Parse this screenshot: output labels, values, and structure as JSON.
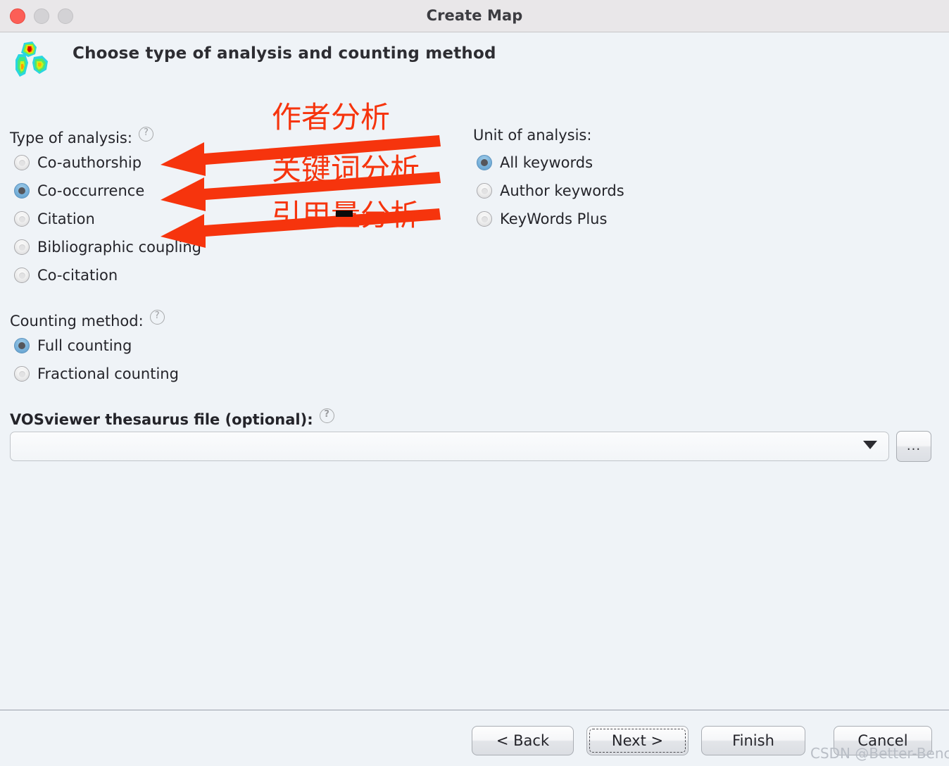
{
  "window": {
    "title": "Create Map",
    "controls": [
      "close-button",
      "minimize-button",
      "maximize-button"
    ]
  },
  "header": {
    "title": "Choose type of analysis and counting method",
    "logo": "vosviewer-heatmap-logo"
  },
  "type_of_analysis": {
    "label": "Type of analysis:",
    "help": "?",
    "options": [
      {
        "label": "Co-authorship",
        "selected": false
      },
      {
        "label": "Co-occurrence",
        "selected": true
      },
      {
        "label": "Citation",
        "selected": false
      },
      {
        "label": "Bibliographic coupling",
        "selected": false
      },
      {
        "label": "Co-citation",
        "selected": false
      }
    ]
  },
  "unit_of_analysis": {
    "label": "Unit of analysis:",
    "options": [
      {
        "label": "All keywords",
        "selected": true
      },
      {
        "label": "Author keywords",
        "selected": false
      },
      {
        "label": "KeyWords Plus",
        "selected": false
      }
    ]
  },
  "counting_method": {
    "label": "Counting method:",
    "help": "?",
    "options": [
      {
        "label": "Full counting",
        "selected": true
      },
      {
        "label": "Fractional counting",
        "selected": false
      }
    ]
  },
  "thesaurus": {
    "label": "VOSviewer thesaurus file (optional):",
    "help": "?",
    "value": "",
    "placeholder": "",
    "browse_label": "...",
    "dropdown_icon": "chevron-down-icon"
  },
  "buttons": {
    "back": "< Back",
    "next": "Next >",
    "finish": "Finish",
    "cancel": "Cancel"
  },
  "annotations": {
    "color": "#f6340d",
    "items": [
      {
        "text": "作者分析",
        "meaning": "author-analysis"
      },
      {
        "text": "关键词分析",
        "meaning": "keyword-analysis"
      },
      {
        "text": "引用量分析",
        "meaning": "citation-count-analysis"
      }
    ]
  },
  "watermark": "CSDN @Better-Bench"
}
